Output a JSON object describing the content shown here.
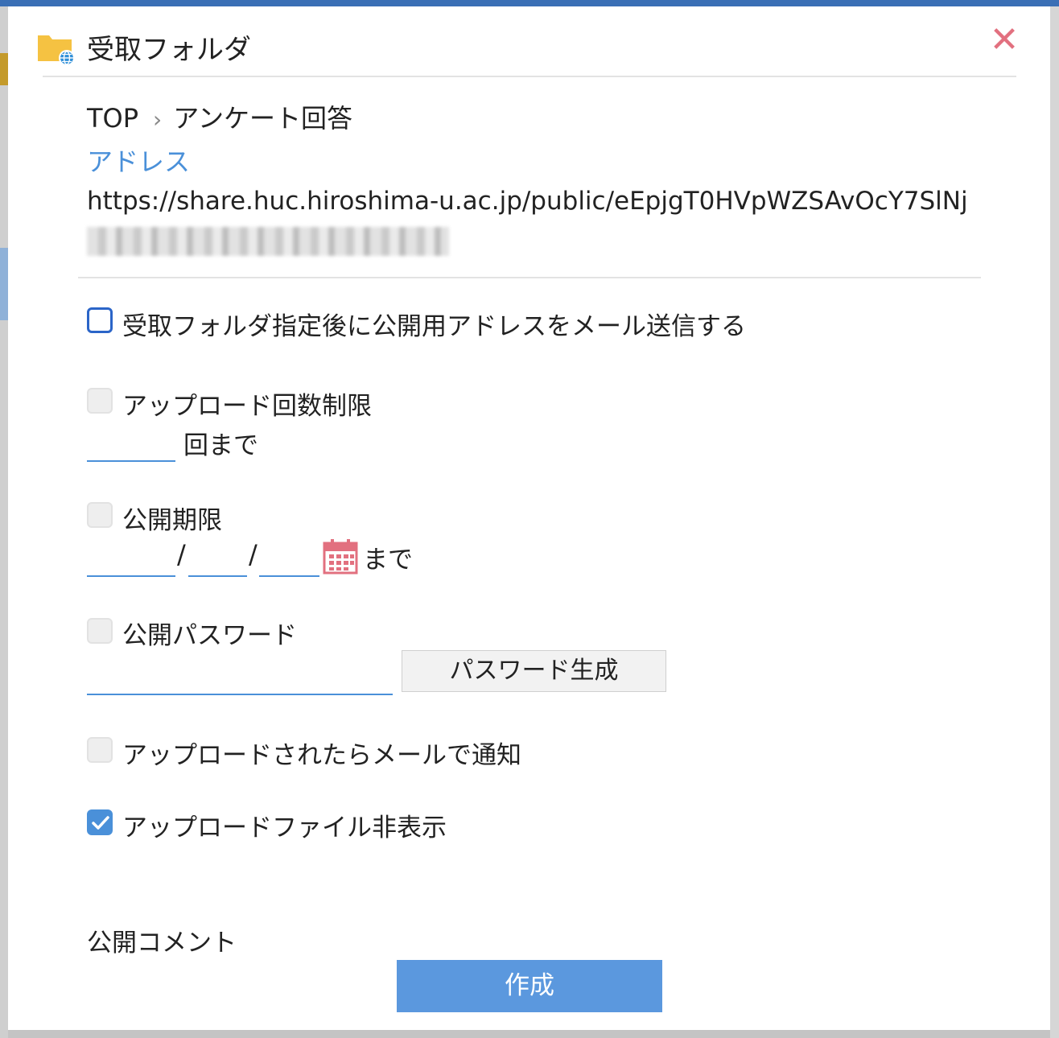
{
  "dialog": {
    "title": "受取フォルダ",
    "close_symbol": "✕"
  },
  "breadcrumb": {
    "root": "TOP",
    "separator": "›",
    "current": "アンケート回答"
  },
  "address": {
    "label": "アドレス",
    "url": "https://share.huc.hiroshima-u.ac.jp/public/eEpjgT0HVpWZSAvOcY7SlNj"
  },
  "options": {
    "send_mail": {
      "label": "受取フォルダ指定後に公開用アドレスをメール送信する",
      "checked": false
    },
    "upload_limit": {
      "label": "アップロード回数制限",
      "checked": false,
      "count": "",
      "suffix": "回まで"
    },
    "expiry": {
      "label": "公開期限",
      "checked": false,
      "year": "",
      "month": "",
      "day": "",
      "date_sep": "/",
      "suffix": "まで"
    },
    "password": {
      "label": "公開パスワード",
      "checked": false,
      "value": "",
      "generate_label": "パスワード生成"
    },
    "notify": {
      "label": "アップロードされたらメールで通知",
      "checked": false
    },
    "hide_files": {
      "label": "アップロードファイル非表示",
      "checked": true
    }
  },
  "comment": {
    "label": "公開コメント"
  },
  "create_label": "作成",
  "colors": {
    "accent": "#4a90d9",
    "close": "#e2707f",
    "create_button": "#5b98de",
    "folder": "#f5c242"
  },
  "icons": [
    "folder-globe-icon",
    "close-icon",
    "chevron-right-icon",
    "calendar-icon",
    "check-icon"
  ]
}
